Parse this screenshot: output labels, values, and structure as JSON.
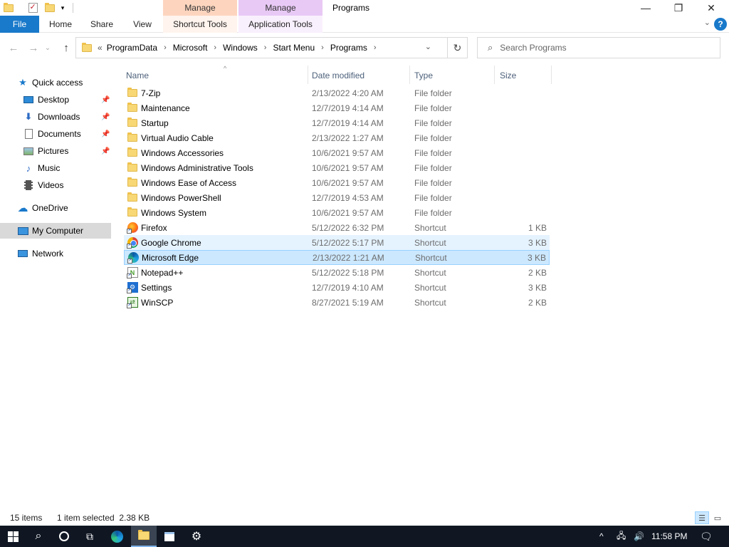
{
  "window": {
    "title": "Programs",
    "context_tabs": [
      {
        "label": "Manage",
        "tool_label": "Shortcut Tools",
        "color": "#fdd5bf"
      },
      {
        "label": "Manage",
        "tool_label": "Application Tools",
        "color": "#e8c9f5"
      }
    ],
    "controls": {
      "minimize": "—",
      "maximize": "❐",
      "close": "✕"
    }
  },
  "ribbon": {
    "tabs": [
      "File",
      "Home",
      "Share",
      "View"
    ],
    "help": "?"
  },
  "nav": {
    "back": "←",
    "forward": "→",
    "recent": "⌄",
    "up": "↑",
    "breadcrumb_lead": "«",
    "breadcrumbs": [
      "ProgramData",
      "Microsoft",
      "Windows",
      "Start Menu",
      "Programs"
    ],
    "refresh": "↻",
    "search_placeholder": "Search Programs"
  },
  "sidebar": {
    "items": [
      {
        "label": "Quick access",
        "icon": "star-icon"
      },
      {
        "label": "Desktop",
        "icon": "desktop-icon",
        "pinned": true
      },
      {
        "label": "Downloads",
        "icon": "download-icon",
        "pinned": true
      },
      {
        "label": "Documents",
        "icon": "documents-icon",
        "pinned": true
      },
      {
        "label": "Pictures",
        "icon": "pictures-icon",
        "pinned": true
      },
      {
        "label": "Music",
        "icon": "music-icon"
      },
      {
        "label": "Videos",
        "icon": "videos-icon"
      },
      {
        "label": "OneDrive",
        "icon": "cloud-icon"
      },
      {
        "label": "My Computer",
        "icon": "computer-icon",
        "selected": true
      },
      {
        "label": "Network",
        "icon": "network-icon"
      }
    ]
  },
  "columns": {
    "name": "Name",
    "date": "Date modified",
    "type": "Type",
    "size": "Size"
  },
  "files": [
    {
      "name": "7-Zip",
      "date": "2/13/2022 4:20 AM",
      "type": "File folder",
      "size": "",
      "icon": "folder-icon"
    },
    {
      "name": "Maintenance",
      "date": "12/7/2019 4:14 AM",
      "type": "File folder",
      "size": "",
      "icon": "folder-icon"
    },
    {
      "name": "Startup",
      "date": "12/7/2019 4:14 AM",
      "type": "File folder",
      "size": "",
      "icon": "folder-icon"
    },
    {
      "name": "Virtual Audio Cable",
      "date": "2/13/2022 1:27 AM",
      "type": "File folder",
      "size": "",
      "icon": "folder-icon"
    },
    {
      "name": "Windows Accessories",
      "date": "10/6/2021 9:57 AM",
      "type": "File folder",
      "size": "",
      "icon": "folder-icon"
    },
    {
      "name": "Windows Administrative Tools",
      "date": "10/6/2021 9:57 AM",
      "type": "File folder",
      "size": "",
      "icon": "folder-icon"
    },
    {
      "name": "Windows Ease of Access",
      "date": "10/6/2021 9:57 AM",
      "type": "File folder",
      "size": "",
      "icon": "folder-icon"
    },
    {
      "name": "Windows PowerShell",
      "date": "12/7/2019 4:53 AM",
      "type": "File folder",
      "size": "",
      "icon": "folder-icon"
    },
    {
      "name": "Windows System",
      "date": "10/6/2021 9:57 AM",
      "type": "File folder",
      "size": "",
      "icon": "folder-icon"
    },
    {
      "name": "Firefox",
      "date": "5/12/2022 6:32 PM",
      "type": "Shortcut",
      "size": "1 KB",
      "icon": "firefox-icon"
    },
    {
      "name": "Google Chrome",
      "date": "5/12/2022 5:17 PM",
      "type": "Shortcut",
      "size": "3 KB",
      "icon": "chrome-icon",
      "state": "hover"
    },
    {
      "name": "Microsoft Edge",
      "date": "2/13/2022 1:21 AM",
      "type": "Shortcut",
      "size": "3 KB",
      "icon": "edge-icon",
      "state": "selected"
    },
    {
      "name": "Notepad++",
      "date": "5/12/2022 5:18 PM",
      "type": "Shortcut",
      "size": "2 KB",
      "icon": "notepadpp-icon"
    },
    {
      "name": "Settings",
      "date": "12/7/2019 4:10 AM",
      "type": "Shortcut",
      "size": "3 KB",
      "icon": "settings-icon"
    },
    {
      "name": "WinSCP",
      "date": "8/27/2021 5:19 AM",
      "type": "Shortcut",
      "size": "2 KB",
      "icon": "winscp-icon"
    }
  ],
  "status": {
    "count": "15 items",
    "selection": "1 item selected  2.38 KB"
  },
  "taskbar": {
    "pinned": [
      "start-icon",
      "search-icon",
      "cortana-icon",
      "task-view-icon",
      "edge-icon",
      "file-explorer-icon",
      "store-icon",
      "settings-icon"
    ],
    "active": "file-explorer-icon",
    "clock": "11:58 PM"
  },
  "colors": {
    "accent": "#1979ca",
    "selection": "#cce8ff",
    "hover": "#e5f3ff",
    "taskbar": "#101723"
  }
}
